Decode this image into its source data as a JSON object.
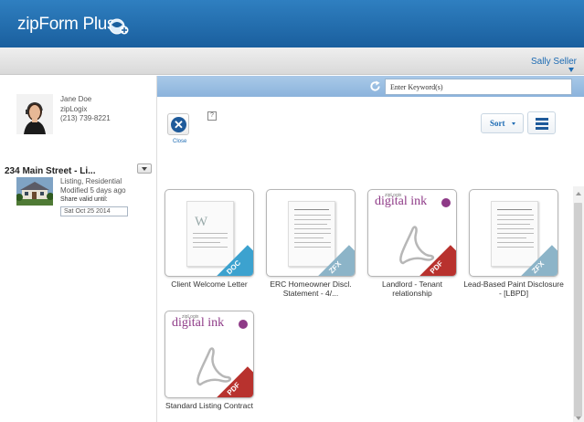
{
  "app": {
    "title_main": "zipForm",
    "title_sub": " Plus"
  },
  "user": {
    "name": "Sally Seller"
  },
  "agent": {
    "name": "Jane Doe",
    "company": "zipLogix",
    "phone": "(213) 739-8221"
  },
  "listing": {
    "title": "234 Main Street - Li...",
    "type": "Listing, Residential",
    "modified": "Modified 5 days ago",
    "share_label": "Share valid until:",
    "share_date": "Sat Oct 25 2014"
  },
  "search": {
    "placeholder": "Enter Keyword(s)"
  },
  "toolbar": {
    "close_label": "Close",
    "help_label": "?",
    "sort_label": "Sort"
  },
  "documents": [
    {
      "name": "Client Welcome Letter",
      "badge": "DOC",
      "type": "doc"
    },
    {
      "name": "ERC Homeowner Discl. Statement - 4/...",
      "badge": "ZFX",
      "type": "zfx"
    },
    {
      "name": "Landlord - Tenant relationship",
      "badge": "PDF",
      "type": "pdf",
      "brand": "digital ink",
      "brand_small": "zipLogix"
    },
    {
      "name": "Lead-Based Paint Disclosure - [LBPD]",
      "badge": "ZFX",
      "type": "zfx"
    },
    {
      "name": "Standard Listing Contract",
      "badge": "PDF",
      "type": "pdf",
      "brand": "digital ink",
      "brand_small": "zipLogix"
    }
  ],
  "colors": {
    "header_blue": "#2f7fc0",
    "accent_blue": "#1d6bb3",
    "pdf_red": "#b8322e",
    "doc_blue": "#3ca2cf",
    "digital_ink_purple": "#8e3a87"
  }
}
